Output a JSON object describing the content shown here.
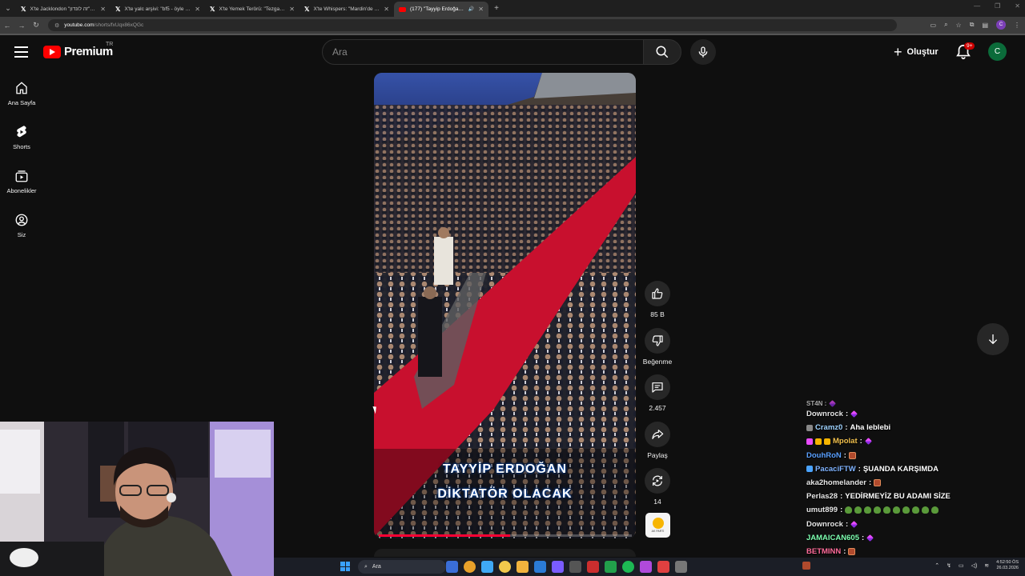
{
  "browser": {
    "tabs": [
      {
        "icon": "x-logo-icon",
        "title": "X'te Jacklondon \"זה לונדון\" Xal..."
      },
      {
        "icon": "x-logo-icon",
        "title": "X'te yalc arşivi: \"bf5 - öyle bi anı...\""
      },
      {
        "icon": "x-logo-icon",
        "title": "X'te Yemek Terörü: \"Tezgah terc...\""
      },
      {
        "icon": "x-logo-icon",
        "title": "X'te Whispers: \"Mardin'de yol ve...\""
      },
      {
        "icon": "youtube-icon",
        "title": "(177) \"Tayyip Erdoğan Dikta...\"",
        "active": true
      }
    ],
    "url_host": "youtube.com",
    "url_path": "/shorts/fxUqx86xQGc",
    "profile_initial": "C"
  },
  "header": {
    "logo_text": "Premium",
    "country": "TR",
    "search_placeholder": "Ara",
    "create_label": "Oluştur",
    "notification_count": "9+",
    "avatar_initial": "C",
    "colors": {
      "brand": "#ff0000",
      "avatar": "#0b6b3a",
      "badge": "#cc0000"
    }
  },
  "sidebar": {
    "items": [
      {
        "label": "Ana Sayfa",
        "icon": "home-icon"
      },
      {
        "label": "Shorts",
        "icon": "shorts-icon"
      },
      {
        "label": "Abonelikler",
        "icon": "subscriptions-icon"
      },
      {
        "label": "Siz",
        "icon": "account-icon"
      }
    ]
  },
  "video": {
    "caption_line1": "TAYYİP ERDOĞAN",
    "caption_line2": "DİKTATÖR OLACAK",
    "progress": 0.52
  },
  "actions": {
    "like_count": "85 B",
    "dislike_label": "Beğenme",
    "comment_count": "2.457",
    "share_label": "Paylaş",
    "remix_count": "14",
    "sound_thumb_text": "AK PARTİ"
  },
  "chat": {
    "messages": [
      {
        "user": "Downrock",
        "color": "#e5e5e5",
        "badges": [],
        "text": "",
        "emotes": [
          "pencil"
        ]
      },
      {
        "user": "Cramz0",
        "color": "#9fd3ff",
        "badges": [
          "#888"
        ],
        "text": "Aha leblebi",
        "emotes": []
      },
      {
        "user": "Mpolat",
        "color": "#f2c14e",
        "badges": [
          "#e94cff",
          "#f7b500",
          "#f7b500"
        ],
        "text": "",
        "emotes": [
          "pencil"
        ]
      },
      {
        "user": "DouhRoN",
        "color": "#5aa0ff",
        "badges": [],
        "text": "",
        "emotes": [
          "box"
        ]
      },
      {
        "user": "PacaciFTW",
        "color": "#7fb3ff",
        "badges": [
          "#4aa3ff"
        ],
        "text": "ŞUANDA KARŞIMDA",
        "emotes": []
      },
      {
        "user": "aka2homelander",
        "color": "#e5e5e5",
        "badges": [],
        "text": "",
        "emotes": [
          "box"
        ]
      },
      {
        "user": "Perlas28",
        "color": "#e5e5e5",
        "badges": [],
        "text": "YEDİRMEYİZ BU ADAMI SİZE",
        "emotes": []
      },
      {
        "user": "umut899",
        "color": "#e5e5e5",
        "badges": [],
        "text": "",
        "emotes": [
          "frog",
          "frog",
          "frog",
          "frog",
          "frog",
          "frog",
          "frog",
          "frog",
          "frog",
          "frog"
        ]
      },
      {
        "user": "Downrock",
        "color": "#e5e5e5",
        "badges": [],
        "text": "",
        "emotes": [
          "pencil"
        ]
      },
      {
        "user": "JAMAICAN605",
        "color": "#7dffb0",
        "badges": [],
        "text": "",
        "emotes": [
          "pencil"
        ]
      },
      {
        "user": "BETMINN",
        "color": "#ff6b9a",
        "badges": [],
        "text": "",
        "emotes": [
          "box"
        ]
      }
    ]
  },
  "taskbar": {
    "search_placeholder": "Ara",
    "time": "4:52:50 ÖS",
    "date": "26.03.2026"
  }
}
